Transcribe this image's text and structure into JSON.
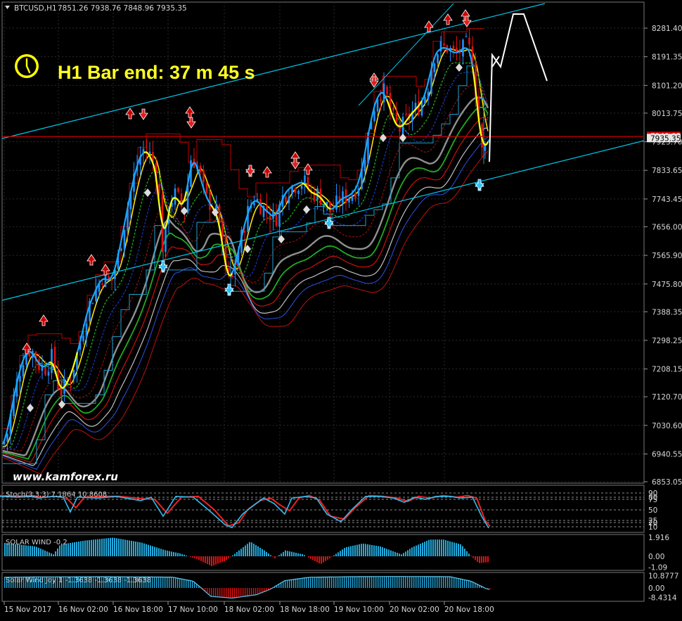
{
  "header": {
    "symbol": "BTCUSD,H1",
    "ohlc": "7851.26 7938.76 7848.96 7935.35"
  },
  "timer": {
    "text": "H1 Bar end: 37 m 45 s"
  },
  "watermark": "www.kamforex.ru",
  "colors": {
    "bg": "#000000",
    "grid": "#2a2a2a",
    "bull": "#1e90ff",
    "bear": "#e01010",
    "envelope": "#c00000",
    "channel": "#00c8e8",
    "signal": "#ffff00",
    "timer": "#ffff22",
    "stoch_main": "#33bbee",
    "stoch_signal": "#ee2222",
    "hist_pos": "#22aadd",
    "hist_neg": "#dd1111"
  },
  "icons": {
    "clock": "clock-icon",
    "arrow_up": "up-arrow-icon",
    "arrow_down": "down-arrow-icon",
    "diamond": "diamond-icon"
  },
  "chart_data": [
    {
      "type": "candlestick",
      "title": "BTCUSD,H1",
      "current_price": "7935.35",
      "hline_price": "7940.02",
      "y_tick_labels": [
        "8281.40",
        "8191.35",
        "8101.20",
        "8013.75",
        "7923.70",
        "7833.65",
        "7743.45",
        "7656.00",
        "7565.90",
        "7475.80",
        "7388.35",
        "7298.25",
        "7208.15",
        "7120.70",
        "7030.60",
        "6940.55",
        "6853.05"
      ],
      "x_tick_labels": [
        "15 Nov 2017",
        "16 Nov 02:00",
        "16 Nov 18:00",
        "17 Nov 10:00",
        "18 Nov 02:00",
        "18 Nov 18:00",
        "19 Nov 10:00",
        "20 Nov 02:00",
        "20 Nov 18:00"
      ],
      "ylim": [
        6853.05,
        8320
      ],
      "close_path": [
        [
          0,
          6950
        ],
        [
          10,
          7000
        ],
        [
          22,
          7150
        ],
        [
          35,
          7260
        ],
        [
          45,
          7270
        ],
        [
          55,
          7220
        ],
        [
          65,
          7210
        ],
        [
          75,
          7250
        ],
        [
          85,
          7130
        ],
        [
          100,
          7180
        ],
        [
          115,
          7300
        ],
        [
          125,
          7400
        ],
        [
          135,
          7450
        ],
        [
          145,
          7500
        ],
        [
          158,
          7480
        ],
        [
          168,
          7560
        ],
        [
          180,
          7700
        ],
        [
          192,
          7830
        ],
        [
          203,
          7900
        ],
        [
          215,
          7880
        ],
        [
          225,
          7800
        ],
        [
          232,
          7560
        ],
        [
          240,
          7730
        ],
        [
          250,
          7760
        ],
        [
          262,
          7700
        ],
        [
          272,
          7880
        ],
        [
          282,
          7840
        ],
        [
          292,
          7750
        ],
        [
          302,
          7720
        ],
        [
          312,
          7680
        ],
        [
          322,
          7500
        ],
        [
          330,
          7490
        ],
        [
          342,
          7610
        ],
        [
          352,
          7700
        ],
        [
          362,
          7750
        ],
        [
          372,
          7720
        ],
        [
          382,
          7700
        ],
        [
          392,
          7680
        ],
        [
          402,
          7750
        ],
        [
          412,
          7780
        ],
        [
          422,
          7790
        ],
        [
          432,
          7800
        ],
        [
          442,
          7760
        ],
        [
          452,
          7760
        ],
        [
          462,
          7730
        ],
        [
          472,
          7700
        ],
        [
          482,
          7740
        ],
        [
          492,
          7750
        ],
        [
          502,
          7760
        ],
        [
          512,
          7800
        ],
        [
          520,
          7900
        ],
        [
          528,
          8000
        ],
        [
          538,
          8080
        ],
        [
          548,
          8080
        ],
        [
          558,
          8000
        ],
        [
          568,
          7960
        ],
        [
          578,
          7990
        ],
        [
          588,
          8020
        ],
        [
          598,
          8040
        ],
        [
          608,
          8090
        ],
        [
          616,
          8190
        ],
        [
          626,
          8220
        ],
        [
          636,
          8220
        ],
        [
          646,
          8200
        ],
        [
          656,
          8210
        ],
        [
          664,
          8230
        ],
        [
          672,
          8190
        ],
        [
          680,
          8010
        ],
        [
          686,
          7880
        ],
        [
          694,
          7935
        ]
      ]
    },
    {
      "type": "line",
      "title": "Stoch(3,3,3) 7.1864 10.8608",
      "y_tick_labels": [
        "90",
        "80",
        "75",
        "50",
        "25",
        "20",
        "10"
      ],
      "series_main": [
        [
          0,
          82
        ],
        [
          25,
          80
        ],
        [
          45,
          82
        ],
        [
          55,
          78
        ],
        [
          75,
          82
        ],
        [
          90,
          80
        ],
        [
          100,
          45
        ],
        [
          110,
          80
        ],
        [
          140,
          78
        ],
        [
          165,
          82
        ],
        [
          200,
          72
        ],
        [
          215,
          80
        ],
        [
          232,
          35
        ],
        [
          250,
          82
        ],
        [
          275,
          80
        ],
        [
          300,
          45
        ],
        [
          320,
          15
        ],
        [
          330,
          8
        ],
        [
          345,
          40
        ],
        [
          360,
          60
        ],
        [
          375,
          78
        ],
        [
          390,
          65
        ],
        [
          405,
          40
        ],
        [
          415,
          78
        ],
        [
          435,
          82
        ],
        [
          450,
          78
        ],
        [
          465,
          40
        ],
        [
          485,
          22
        ],
        [
          500,
          50
        ],
        [
          520,
          82
        ],
        [
          540,
          82
        ],
        [
          560,
          78
        ],
        [
          575,
          68
        ],
        [
          590,
          80
        ],
        [
          605,
          75
        ],
        [
          620,
          82
        ],
        [
          640,
          82
        ],
        [
          655,
          78
        ],
        [
          672,
          80
        ],
        [
          685,
          35
        ],
        [
          695,
          7
        ]
      ],
      "series_signal": [
        [
          0,
          84
        ],
        [
          25,
          82
        ],
        [
          45,
          84
        ],
        [
          60,
          80
        ],
        [
          80,
          82
        ],
        [
          95,
          78
        ],
        [
          108,
          55
        ],
        [
          120,
          80
        ],
        [
          150,
          82
        ],
        [
          170,
          82
        ],
        [
          205,
          76
        ],
        [
          220,
          75
        ],
        [
          238,
          42
        ],
        [
          258,
          80
        ],
        [
          282,
          82
        ],
        [
          305,
          50
        ],
        [
          325,
          12
        ],
        [
          340,
          20
        ],
        [
          352,
          50
        ],
        [
          370,
          72
        ],
        [
          385,
          78
        ],
        [
          398,
          62
        ],
        [
          412,
          48
        ],
        [
          425,
          78
        ],
        [
          440,
          84
        ],
        [
          455,
          72
        ],
        [
          470,
          35
        ],
        [
          490,
          28
        ],
        [
          505,
          55
        ],
        [
          525,
          84
        ],
        [
          545,
          82
        ],
        [
          565,
          78
        ],
        [
          580,
          70
        ],
        [
          595,
          82
        ],
        [
          612,
          78
        ],
        [
          630,
          84
        ],
        [
          650,
          80
        ],
        [
          665,
          84
        ],
        [
          678,
          78
        ],
        [
          690,
          25
        ],
        [
          697,
          11
        ]
      ]
    },
    {
      "type": "bar",
      "title": "SOLAR WIND -0.2",
      "y_tick_labels": [
        "1.916",
        "0.00",
        "-1.09"
      ],
      "envelope": [
        [
          0,
          1.4
        ],
        [
          50,
          1.0
        ],
        [
          75,
          0.2
        ],
        [
          85,
          1.2
        ],
        [
          120,
          1.6
        ],
        [
          160,
          1.9
        ],
        [
          200,
          1.4
        ],
        [
          235,
          0.6
        ],
        [
          255,
          0.3
        ],
        [
          280,
          -0.3
        ],
        [
          300,
          -1.0
        ],
        [
          318,
          -0.5
        ],
        [
          332,
          0.2
        ],
        [
          355,
          1.5
        ],
        [
          375,
          0.6
        ],
        [
          390,
          -0.2
        ],
        [
          405,
          0.6
        ],
        [
          430,
          0.2
        ],
        [
          455,
          -0.8
        ],
        [
          468,
          -0.2
        ],
        [
          490,
          0.9
        ],
        [
          515,
          1.3
        ],
        [
          540,
          1.0
        ],
        [
          570,
          0.2
        ],
        [
          585,
          0.9
        ],
        [
          610,
          1.7
        ],
        [
          630,
          1.7
        ],
        [
          655,
          1.2
        ],
        [
          668,
          0.1
        ],
        [
          680,
          -0.7
        ],
        [
          692,
          -0.6
        ]
      ]
    },
    {
      "type": "bar",
      "title": "Solar Wind Joy 1 -1.3638 -1.3638 -1.3638",
      "y_tick_labels": [
        "10.8777",
        "0.00",
        "-8.4314"
      ],
      "envelope": [
        [
          0,
          9.5
        ],
        [
          60,
          9.8
        ],
        [
          150,
          10.0
        ],
        [
          245,
          9.6
        ],
        [
          275,
          6.0
        ],
        [
          300,
          -7.5
        ],
        [
          330,
          -9.0
        ],
        [
          365,
          -6.0
        ],
        [
          385,
          -1.0
        ],
        [
          405,
          6.5
        ],
        [
          440,
          9.5
        ],
        [
          500,
          10.0
        ],
        [
          560,
          10.2
        ],
        [
          640,
          10.0
        ],
        [
          670,
          6.0
        ],
        [
          690,
          -0.2
        ],
        [
          696,
          -1.4
        ]
      ]
    }
  ]
}
